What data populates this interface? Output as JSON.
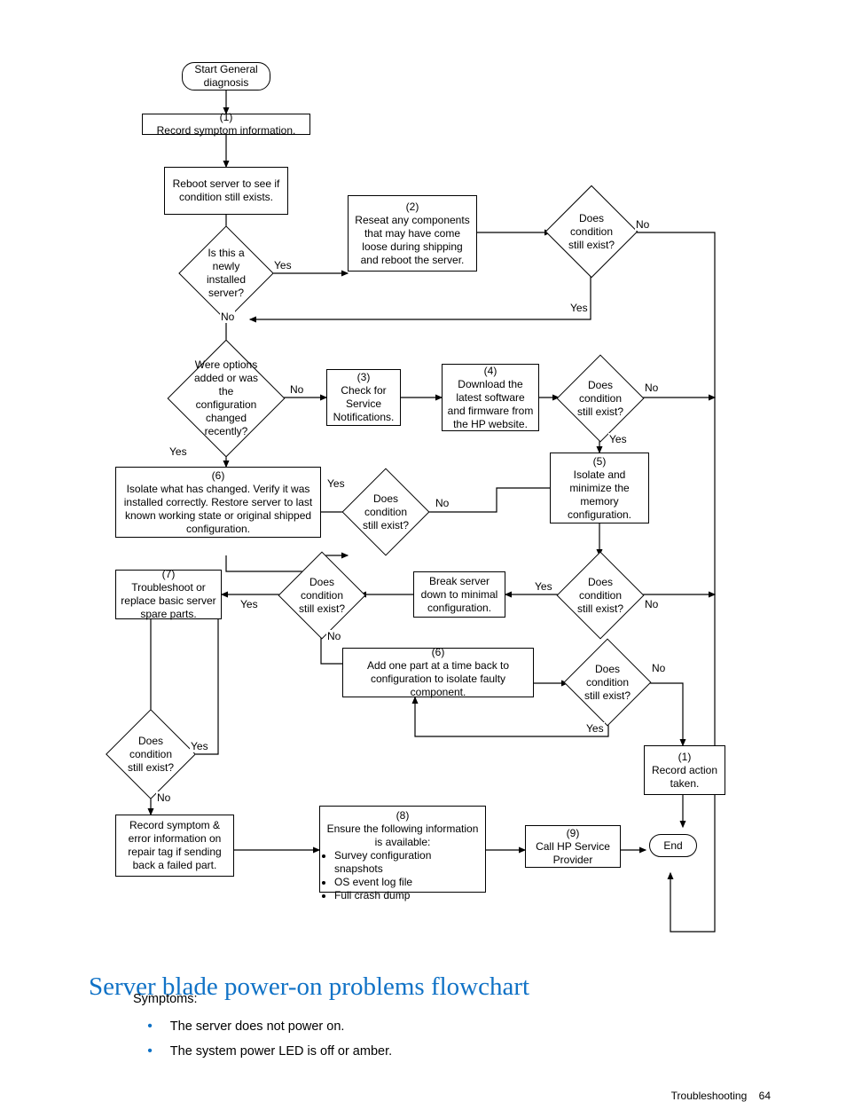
{
  "flow": {
    "start": "Start General diagnosis",
    "n1": "(1)\nRecord symptom information.",
    "reboot": "Reboot server to see if condition still exists.",
    "d_newly": "Is this a newly installed server?",
    "n2": "(2)\nReseat any components that may have come loose during shipping and reboot the server.",
    "d_c1": "Does condition still exist?",
    "d_opts": "Were options added or was the configuration changed recently?",
    "n3": "(3)\nCheck for Service Notifications.",
    "n4": "(4)\nDownload the latest software and firmware from the HP website.",
    "d_c2": "Does condition still exist?",
    "n5": "(5)\nIsolate and minimize the memory configuration.",
    "n6": "(6)\nIsolate what has changed. Verify it was installed correctly.  Restore server to last known working state or original shipped configuration.",
    "d_c3": "Does condition still exist?",
    "n7": "(7)\nTroubleshoot or replace basic server spare parts.",
    "d_c4": "Does condition still exist?",
    "break": "Break server down to minimal configuration.",
    "d_c5": "Does condition still exist?",
    "n6b": "(6)\nAdd one part at a time back to configuration to isolate faulty component.",
    "d_c6": "Does condition still exist?",
    "d_c7": "Does condition still exist?",
    "rec_tag": "Record symptom & error information on repair tag if sending back a failed part.",
    "n8_top": "(8)\nEnsure the following information is available:",
    "n8_b1": "Survey configuration snapshots",
    "n8_b2": "OS event log file",
    "n8_b3": "Full crash dump",
    "n9": "(9)\nCall HP Service Provider",
    "n1b": "(1)\nRecord action taken.",
    "end": "End",
    "yes": "Yes",
    "no": "No"
  },
  "heading": "Server blade power-on problems flowchart",
  "symptoms_label": "Symptoms:",
  "bullets": {
    "b1": "The server does not power on.",
    "b2": "The system power LED is off or amber."
  },
  "footer": {
    "section": "Troubleshooting",
    "page": "64"
  }
}
